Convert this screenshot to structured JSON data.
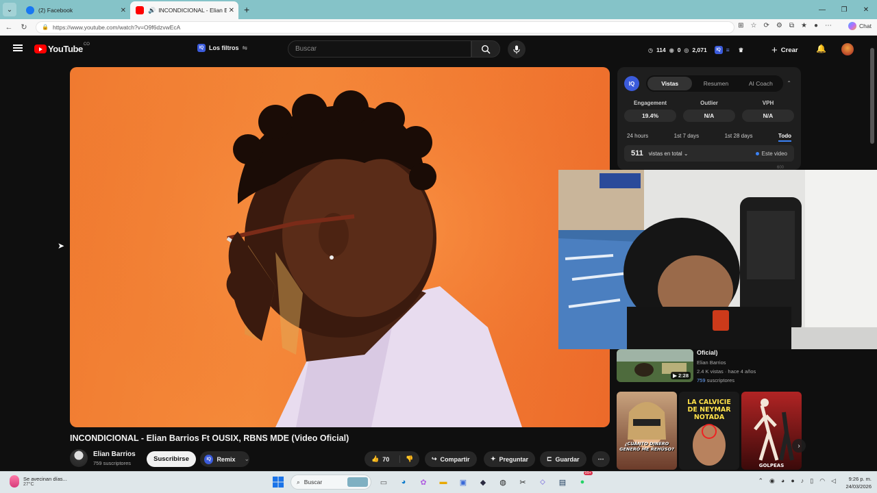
{
  "browser": {
    "tabs": [
      {
        "label": "(2) Facebook",
        "active": false
      },
      {
        "label": "INCONDICIONAL - Elian Barrios",
        "active": true
      }
    ],
    "url": "https://www.youtube.com/watch?v=O9f6dzvwEcA",
    "chat_label": "Chat"
  },
  "header": {
    "logo": "YouTube",
    "country": "CO",
    "filters_label": "Los filtros",
    "search_placeholder": "Buscar",
    "stats": {
      "a": "114",
      "b": "0",
      "c": "2,071"
    },
    "create_label": "Crear"
  },
  "video": {
    "title": "INCONDICIONAL - Elian Barrios Ft OUSIX, RBNS MDE (Video Oficial)",
    "channel": "Elian Barrios",
    "subscribers": "759 suscriptores",
    "subscribe_label": "Suscribirse",
    "remix_label": "Remix",
    "likes": "70",
    "share_label": "Compartir",
    "ask_label": "Preguntar",
    "save_label": "Guardar"
  },
  "panel": {
    "tabs": [
      "Vistas",
      "Resumen",
      "AI Coach"
    ],
    "active_tab": "Vistas",
    "metrics": [
      {
        "label": "Engagement",
        "value": "19.4%"
      },
      {
        "label": "Outlier",
        "value": "N/A"
      },
      {
        "label": "VPH",
        "value": "N/A"
      }
    ],
    "ranges": [
      "24 hours",
      "1st 7 days",
      "1st 28 days",
      "Todo"
    ],
    "active_range": "Todo",
    "total_views": "511",
    "total_label": "vistas en total",
    "legend": "Este video",
    "axis_top": "600"
  },
  "related": {
    "title": "Oficial)",
    "channel": "Elian Barrios",
    "views": "2.4 K vistas · hace 4 años",
    "subs_num": "759",
    "subs_text": "suscriptores",
    "duration": "2:28"
  },
  "shorts": [
    {
      "caption": "¿CUÁNTO DINERO GENERÓ ME REHÚSO?"
    },
    {
      "caption": "LA CALVICIE DE NEYMAR NOTADA"
    },
    {
      "caption": "GOLPEAS"
    }
  ],
  "taskbar": {
    "weather_text": "Se avecinan días...",
    "temp": "27°C",
    "search_label": "Buscar",
    "badge": "99+",
    "time": "9:26 p. m.",
    "date": "24/03/2026"
  },
  "colors": {
    "accent": "#3b82f6",
    "yt_red": "#ff0000",
    "tab_bar": "#85c3c8"
  }
}
